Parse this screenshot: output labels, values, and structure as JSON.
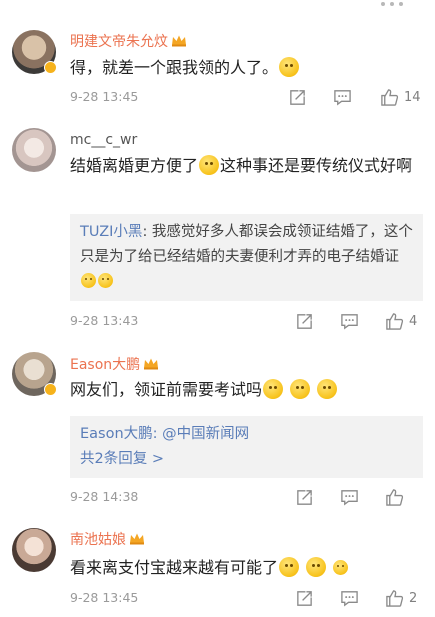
{
  "comments": [
    {
      "username": "明建文帝朱允炆",
      "text": "得，就差一个跟我领的人了。",
      "time": "9-28 13:45",
      "likes": "14"
    },
    {
      "username": "mc__c_wr",
      "text_a": "结婚离婚更方便了",
      "text_b": "这种事还是要传统仪式好啊",
      "reply": {
        "author": "TUZI小黑",
        "text": ": 我感觉好多人都误会成领证结婚了，这个只是为了给已经结婚的夫妻便利才弄的电子结婚证"
      },
      "time": "9-28 13:43",
      "likes": "4"
    },
    {
      "username": "Eason大鹏",
      "text": "网友们，领证前需要考试吗",
      "reply": {
        "author": "Eason大鹏",
        "text": ": @中国新闻网",
        "more": "共2条回复 >"
      },
      "time": "9-28 14:38",
      "likes": ""
    },
    {
      "username": "南池姑娘",
      "text": "看来离支付宝越来越有可能了",
      "time": "9-28 13:45",
      "likes": "2"
    }
  ],
  "colors": {
    "username": "#eb7350",
    "link": "#5a7db8",
    "meta": "#9a9a9a",
    "badge": "#f6b21b"
  },
  "icons": [
    "more-dots-icon",
    "repost-icon",
    "reply-icon",
    "like-icon",
    "verified-badge-icon",
    "crown-icon",
    "emoji-icon"
  ]
}
